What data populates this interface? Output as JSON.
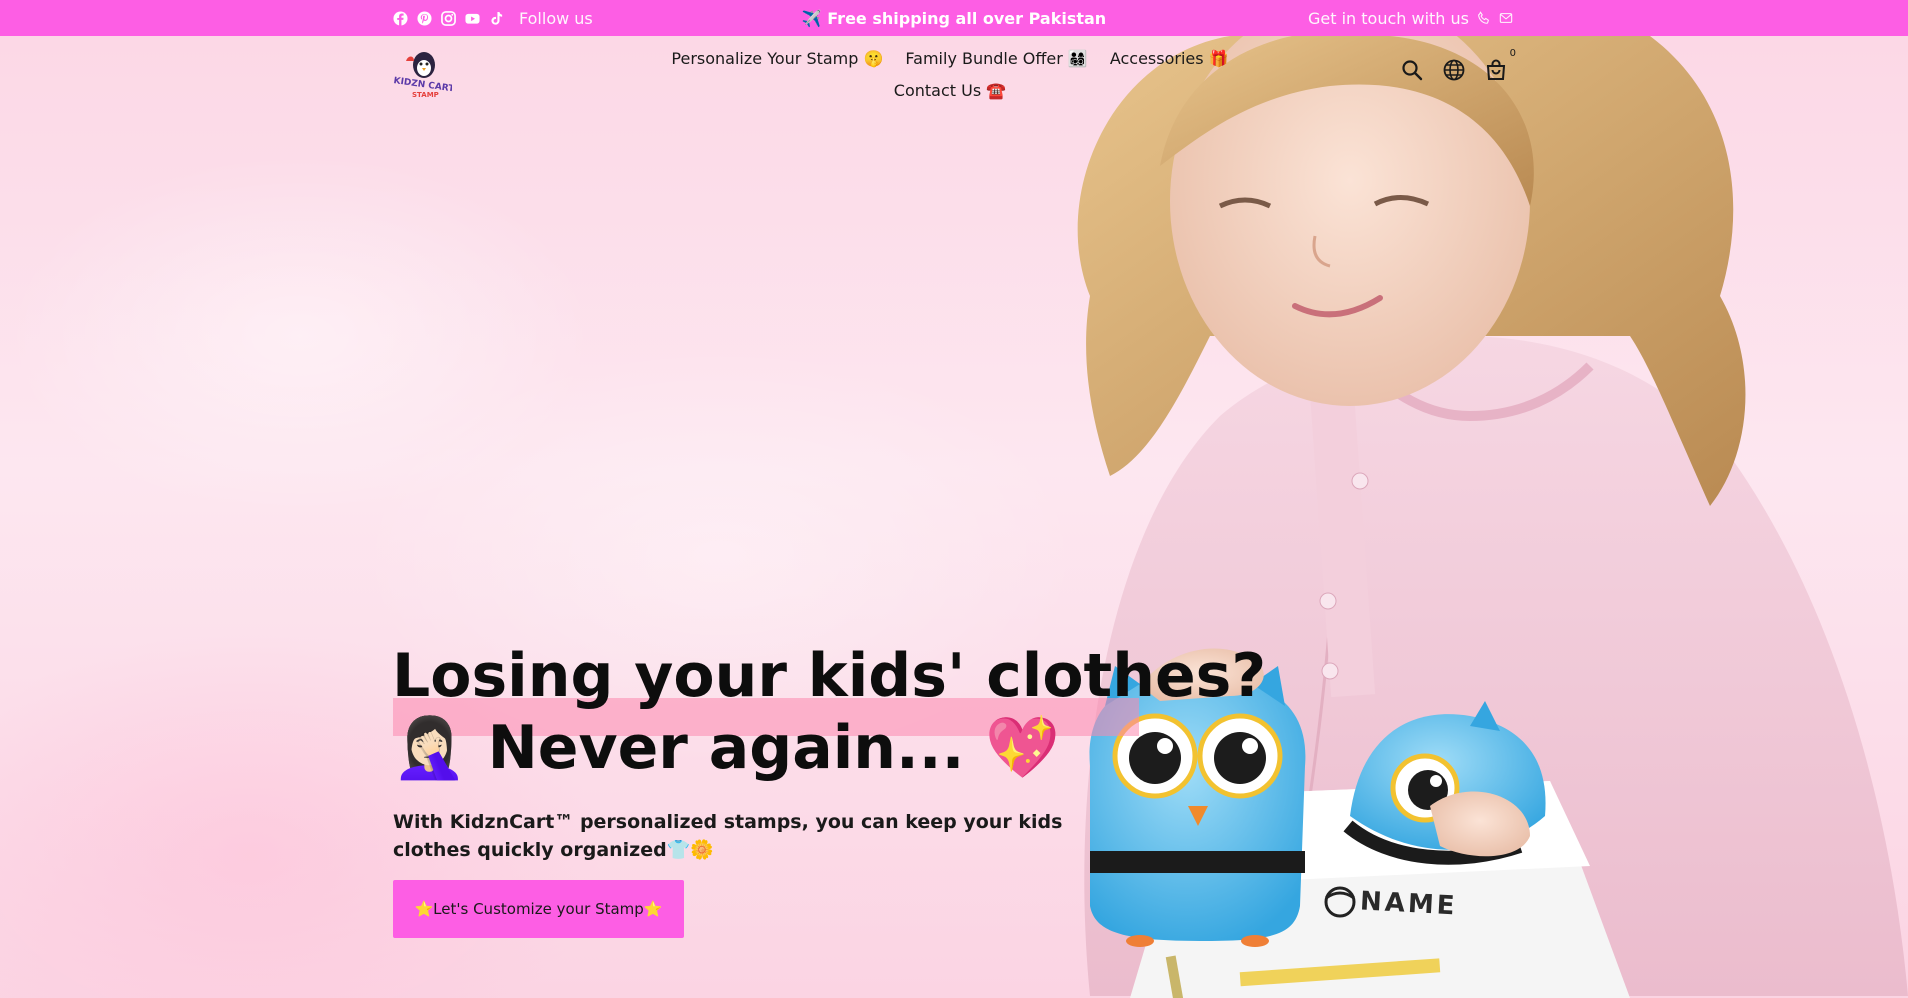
{
  "topbar": {
    "follow_label": "Follow us",
    "social_icons": [
      "facebook-icon",
      "pinterest-icon",
      "instagram-icon",
      "youtube-icon",
      "tiktok-icon"
    ],
    "announcement": "✈️ Free shipping all over Pakistan",
    "contact_label": "Get in touch with us",
    "background_color": "#fd5ee4"
  },
  "header": {
    "logo_text": "KIDZN CART STAMP",
    "nav": [
      {
        "label": "Personalize Your Stamp 🤫"
      },
      {
        "label": "Family Bundle Offer 👨‍👩‍👧‍👦"
      },
      {
        "label": "Accessories 🎁"
      },
      {
        "label": "Contact Us ☎️"
      }
    ],
    "cart_count": "0"
  },
  "hero": {
    "headline_line1": "Losing your kids' clothes?",
    "headline_line2": "🤦🏻‍♀️ Never again... 💖",
    "subtext": "With KidznCart™ personalized stamps, you can keep your kids clothes quickly organized👕🌼",
    "cta_label": "⭐Let's Customize your Stamp⭐",
    "stamp_text": "NAME",
    "accent_color": "#fd5ee4",
    "highlight_color": "#fb88af"
  }
}
